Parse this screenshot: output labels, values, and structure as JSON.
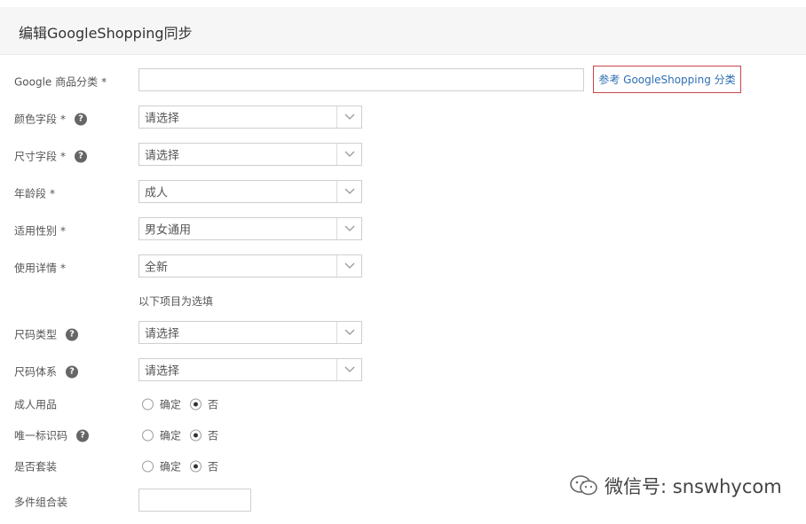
{
  "header": {
    "title": "编辑GoogleShopping同步"
  },
  "google_category": {
    "label": "Google 商品分类",
    "required": "*",
    "value": "",
    "ref_button": "参考 GoogleShopping 分类"
  },
  "fields": [
    {
      "label": "颜色字段",
      "required": "*",
      "value": "请选择"
    },
    {
      "label": "尺寸字段",
      "required": "*",
      "value": "请选择"
    },
    {
      "label": "年龄段",
      "required": "*",
      "value": "成人"
    },
    {
      "label": "适用性别",
      "required": "*",
      "value": "男女通用"
    },
    {
      "label": "使用详情",
      "required": "*",
      "value": "全新"
    }
  ],
  "optional_note": "以下项目为选填",
  "optional_fields": [
    {
      "label": "尺码类型",
      "value": "请选择"
    },
    {
      "label": "尺码体系",
      "value": "请选择"
    }
  ],
  "radio_rows": [
    {
      "label": "成人用品",
      "yes": "确定",
      "no": "否",
      "selected": "no"
    },
    {
      "label": "唯一标识码",
      "yes": "确定",
      "no": "否",
      "selected": "no"
    },
    {
      "label": "是否套装",
      "yes": "确定",
      "no": "否",
      "selected": "no"
    }
  ],
  "multipack": {
    "label": "多件组合装",
    "value": ""
  },
  "help_icon": "?",
  "watermark": {
    "text": "微信号: snswhycom"
  }
}
